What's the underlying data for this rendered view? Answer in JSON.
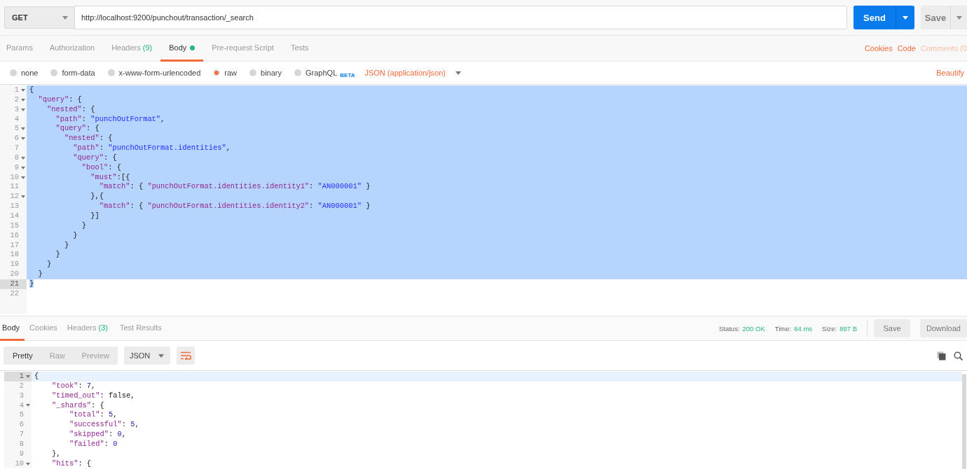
{
  "request": {
    "method": "GET",
    "url": "http://localhost:9200/punchout/transaction/_search",
    "send": "Send",
    "save": "Save"
  },
  "request_tabs": [
    {
      "label": "Params",
      "selected": false
    },
    {
      "label": "Authorization",
      "selected": false
    },
    {
      "label": "Headers",
      "count": "(9)",
      "selected": false
    },
    {
      "label": "Body",
      "selected": true,
      "has_content": true
    },
    {
      "label": "Pre-request Script",
      "selected": false
    },
    {
      "label": "Tests",
      "selected": false
    }
  ],
  "request_links": [
    {
      "label": "Cookies",
      "disabled": false
    },
    {
      "label": "Code",
      "disabled": false
    },
    {
      "label": "Comments (0",
      "disabled": true
    }
  ],
  "body_types": [
    {
      "label": "none",
      "selected": false
    },
    {
      "label": "form-data",
      "selected": false
    },
    {
      "label": "x-www-form-urlencoded",
      "selected": false
    },
    {
      "label": "raw",
      "selected": true
    },
    {
      "label": "binary",
      "selected": false
    },
    {
      "label": "GraphQL",
      "selected": false,
      "badge": "BETA"
    }
  ],
  "content_type": "JSON (application/json)",
  "beautify": "Beautify",
  "request_editor": {
    "lines": [
      {
        "number": "1",
        "text": "{",
        "fold": true,
        "selected": true,
        "active": false
      },
      {
        "number": "2",
        "text": "  \"query\": {",
        "fold": true,
        "selected": true,
        "active": false
      },
      {
        "number": "3",
        "text": "    \"nested\": {",
        "fold": true,
        "selected": true,
        "active": false
      },
      {
        "number": "4",
        "text": "      \"path\": \"punchOutFormat\",",
        "fold": false,
        "selected": true,
        "active": false
      },
      {
        "number": "5",
        "text": "      \"query\": {",
        "fold": true,
        "selected": true,
        "active": false
      },
      {
        "number": "6",
        "text": "        \"nested\": {",
        "fold": true,
        "selected": true,
        "active": false
      },
      {
        "number": "7",
        "text": "          \"path\": \"punchOutFormat.identities\",",
        "fold": false,
        "selected": true,
        "active": false
      },
      {
        "number": "8",
        "text": "          \"query\": {",
        "fold": true,
        "selected": true,
        "active": false
      },
      {
        "number": "9",
        "text": "            \"bool\": {",
        "fold": true,
        "selected": true,
        "active": false
      },
      {
        "number": "10",
        "text": "              \"must\":[{",
        "fold": true,
        "selected": true,
        "active": false
      },
      {
        "number": "11",
        "text": "                \"match\": { \"punchOutFormat.identities.identity1\": \"AN000001\" }",
        "fold": false,
        "selected": true,
        "active": false
      },
      {
        "number": "12",
        "text": "              },{",
        "fold": true,
        "selected": true,
        "active": false
      },
      {
        "number": "13",
        "text": "                \"match\": { \"punchOutFormat.identities.identity2\": \"AN000001\" }",
        "fold": false,
        "selected": true,
        "active": false
      },
      {
        "number": "14",
        "text": "              }]",
        "fold": false,
        "selected": true,
        "active": false
      },
      {
        "number": "15",
        "text": "            }",
        "fold": false,
        "selected": true,
        "active": false
      },
      {
        "number": "16",
        "text": "          }",
        "fold": false,
        "selected": true,
        "active": false
      },
      {
        "number": "17",
        "text": "        }",
        "fold": false,
        "selected": true,
        "active": false
      },
      {
        "number": "18",
        "text": "      }",
        "fold": false,
        "selected": true,
        "active": false
      },
      {
        "number": "19",
        "text": "    }",
        "fold": false,
        "selected": true,
        "active": false
      },
      {
        "number": "20",
        "text": "  }",
        "fold": false,
        "selected": true,
        "active": false
      },
      {
        "number": "21",
        "text": "}",
        "fold": false,
        "selected": true,
        "active": true
      },
      {
        "number": "22",
        "fold": false,
        "selected": false,
        "active": false
      }
    ]
  },
  "response_tabs": [
    {
      "label": "Body",
      "selected": true
    },
    {
      "label": "Cookies",
      "selected": false
    },
    {
      "label": "Headers",
      "count": "(3)",
      "selected": false
    },
    {
      "label": "Test Results",
      "selected": false
    }
  ],
  "response_meta": [
    {
      "label": "Status:",
      "value": "200 OK"
    },
    {
      "label": "Time:",
      "value": "84 ms"
    },
    {
      "label": "Size:",
      "value": "897 B"
    }
  ],
  "response_actions": [
    "Save",
    "Download"
  ],
  "view_modes": [
    {
      "label": "Pretty",
      "selected": true
    },
    {
      "label": "Raw",
      "selected": false
    },
    {
      "label": "Preview",
      "selected": false
    }
  ],
  "format": "JSON",
  "response_editor": {
    "lines": [
      {
        "number": "1",
        "text": "{",
        "fold": true,
        "selected": false,
        "active": true
      },
      {
        "number": "2",
        "text": "    \"took\": 7,",
        "fold": false,
        "selected": false,
        "active": false
      },
      {
        "number": "3",
        "text": "    \"timed_out\": false,",
        "fold": false,
        "selected": false,
        "active": false
      },
      {
        "number": "4",
        "text": "    \"_shards\": {",
        "fold": true,
        "selected": false,
        "active": false
      },
      {
        "number": "5",
        "text": "        \"total\": 5,",
        "fold": false,
        "selected": false,
        "active": false
      },
      {
        "number": "6",
        "text": "        \"successful\": 5,",
        "fold": false,
        "selected": false,
        "active": false
      },
      {
        "number": "7",
        "text": "        \"skipped\": 0,",
        "fold": false,
        "selected": false,
        "active": false
      },
      {
        "number": "8",
        "text": "        \"failed\": 0",
        "fold": false,
        "selected": false,
        "active": false
      },
      {
        "number": "9",
        "text": "    },",
        "fold": false,
        "selected": false,
        "active": false
      },
      {
        "number": "10",
        "text": "    \"hits\": {",
        "fold": true,
        "selected": false,
        "active": false
      }
    ]
  }
}
